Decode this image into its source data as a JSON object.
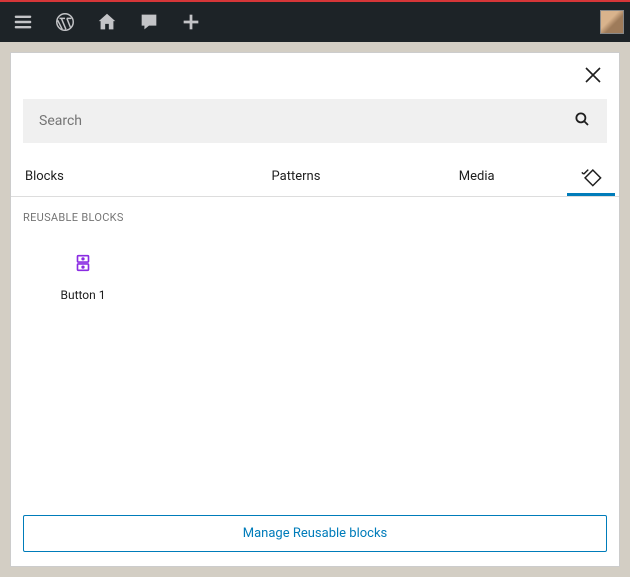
{
  "search": {
    "placeholder": "Search"
  },
  "tabs": {
    "blocks": "Blocks",
    "patterns": "Patterns",
    "media": "Media"
  },
  "section": {
    "reusable_label": "REUSABLE BLOCKS"
  },
  "blocks": {
    "item0": {
      "label": "Button 1"
    }
  },
  "footer": {
    "manage_label": "Manage Reusable blocks"
  },
  "colors": {
    "accent": "#007cba",
    "reusable_icon": "#8a2be2"
  }
}
